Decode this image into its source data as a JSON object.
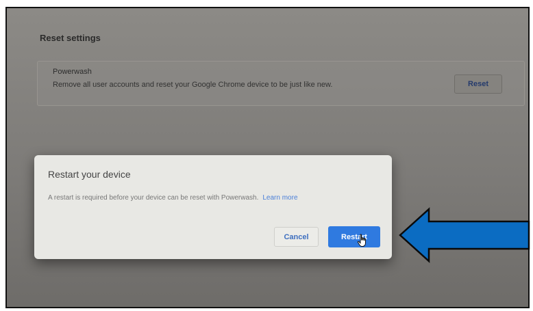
{
  "settings": {
    "section_title": "Reset settings",
    "powerwash": {
      "title": "Powerwash",
      "description": "Remove all user accounts and reset your Google Chrome device to be just like new.",
      "reset_label": "Reset"
    }
  },
  "dialog": {
    "title": "Restart your device",
    "body": "A restart is required before your device can be reset with Powerwash.",
    "learn_more": "Learn more",
    "cancel_label": "Cancel",
    "restart_label": "Restart"
  },
  "icons": {
    "cursor": "hand-pointer-icon",
    "annotation": "arrow-left-icon"
  },
  "colors": {
    "accent_blue": "#2f7ae0",
    "annotation_blue": "#0b6cc2",
    "link_blue": "#4a7fd8"
  }
}
